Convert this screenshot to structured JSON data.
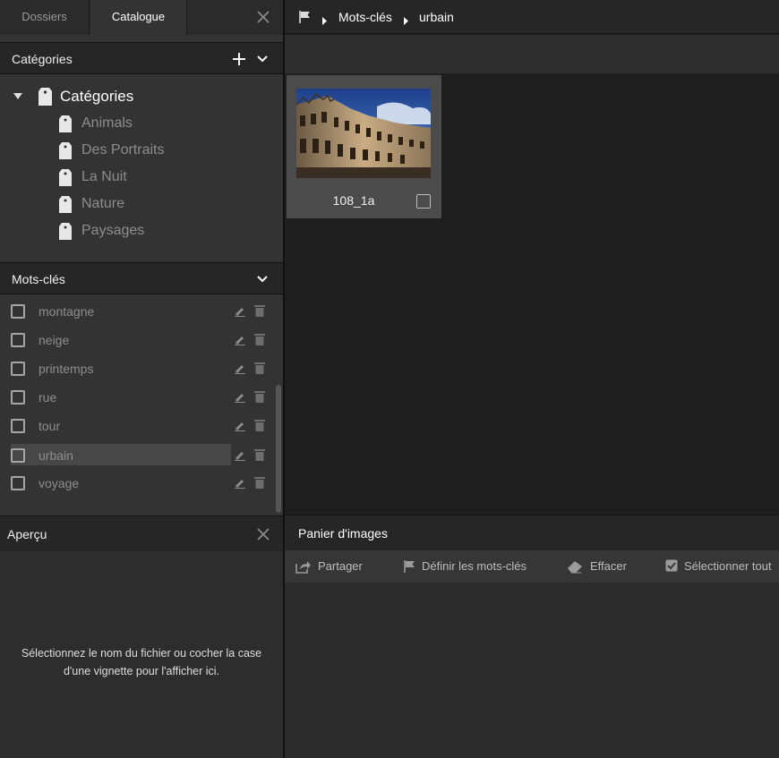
{
  "tabs": {
    "dossiers": "Dossiers",
    "catalogue": "Catalogue"
  },
  "categories_panel": {
    "title": "Catégories",
    "root_label": "Catégories",
    "items": [
      "Animals",
      "Des Portraits",
      "La Nuit",
      "Nature",
      "Paysages"
    ]
  },
  "keywords_panel": {
    "title": "Mots-clés",
    "items": [
      "montagne",
      "neige",
      "printemps",
      "rue",
      "tour",
      "urbain",
      "voyage"
    ],
    "highlighted": "urbain"
  },
  "preview_panel": {
    "title": "Aperçu",
    "message_line1": "Sélectionnez le nom du fichier ou cocher la case",
    "message_line2": "d'une vignette pour l'afficher ici."
  },
  "breadcrumb": {
    "level1": "Mots-clés",
    "level2": "urbain"
  },
  "thumbnail": {
    "name": "108_1a",
    "checked": false
  },
  "basket": {
    "title": "Panier d'images",
    "share": "Partager",
    "set_keywords": "Définir les mots-clés",
    "clear": "Effacer",
    "select_all": "Sélectionner tout"
  },
  "colors": {
    "panel": "#333333",
    "header": "#262626",
    "grid_bg": "#1e1e1e",
    "muted_text": "#8d8d8d"
  }
}
